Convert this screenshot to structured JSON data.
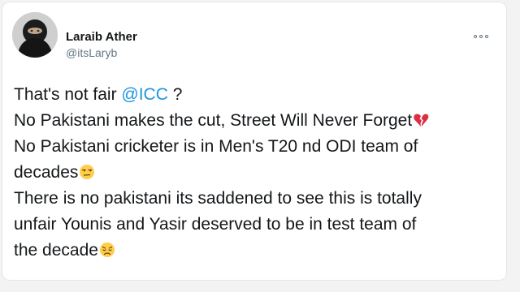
{
  "tweet": {
    "author": {
      "display_name": "Laraib Ather",
      "handle": "@itsLaryb"
    },
    "lines": {
      "l1_before": "That's not fair ",
      "l1_mention": "@ICC",
      "l1_after": " ?",
      "l2": "No Pakistani makes the cut, Street Will Never Forget",
      "l3": "No Pakistani cricketer is in Men's T20 nd ODI team of",
      "l4": "decades",
      "l5": "There is no pakistani its saddened to see this is totally",
      "l6": "unfair Younis and Yasir deserved to be in test team of",
      "l7": "the decade"
    },
    "emojis": {
      "e1": "broken-heart-emoji",
      "e2": "unamused-face-emoji",
      "e3": "disappointed-face-emoji"
    }
  },
  "colors": {
    "mention": "#1b95e0",
    "text": "#14171a",
    "muted": "#657786"
  }
}
